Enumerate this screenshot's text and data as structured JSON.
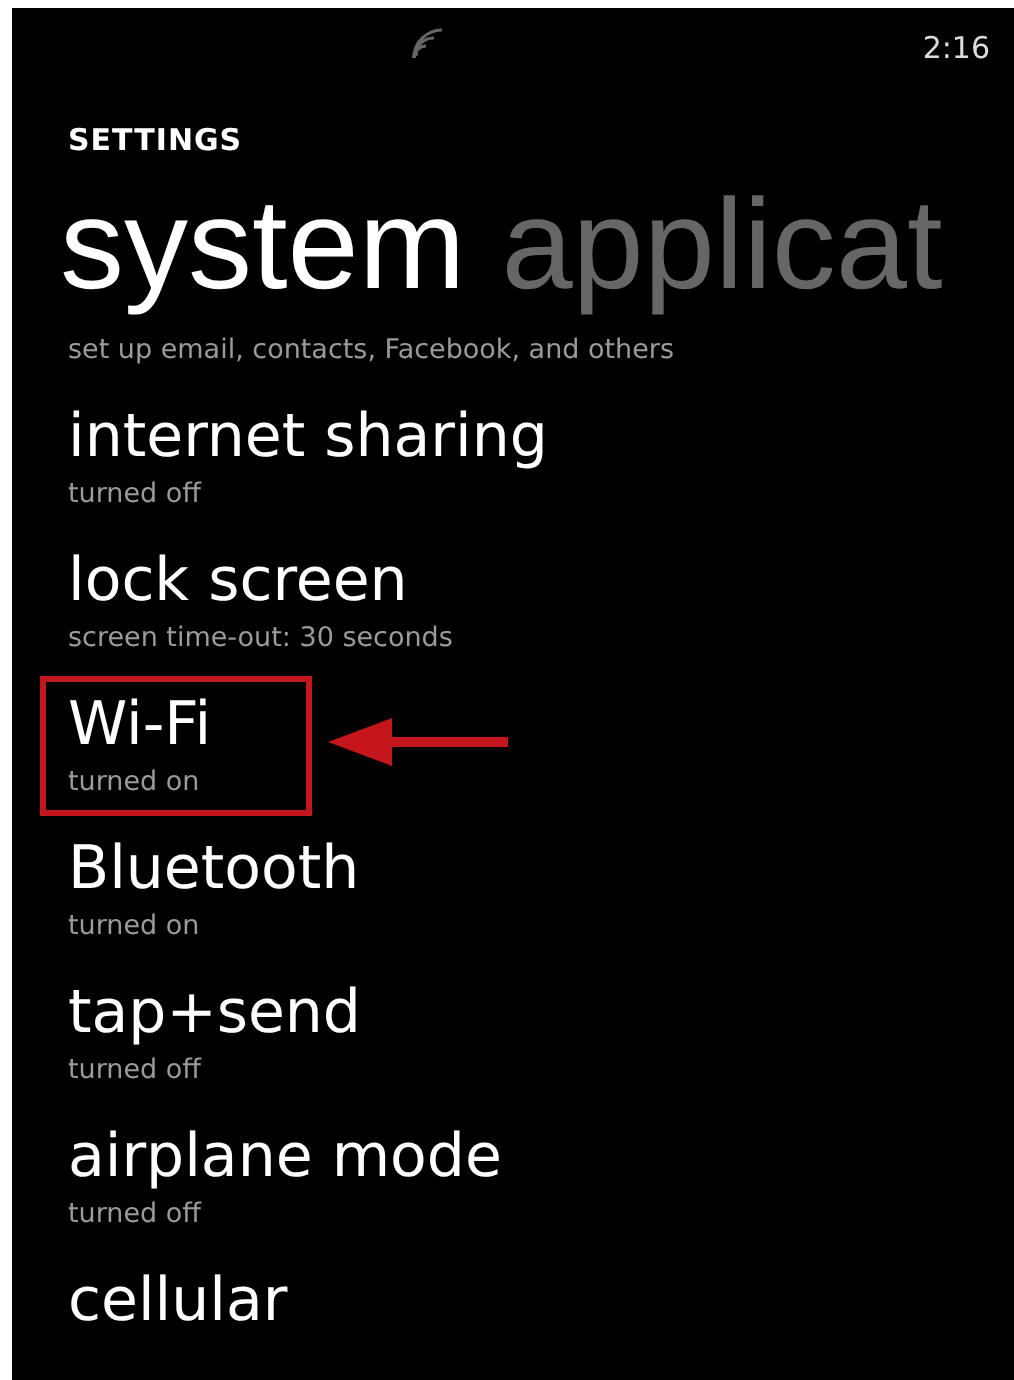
{
  "status_bar": {
    "time": "2:16"
  },
  "header": "SETTINGS",
  "pivots": [
    {
      "label": "system",
      "selected": true
    },
    {
      "label": "applicat",
      "selected": false
    }
  ],
  "items": [
    {
      "subtitle": "set up email, contacts, Facebook, and others",
      "highlighted": false
    },
    {
      "title": "internet sharing",
      "subtitle": "turned off",
      "highlighted": false
    },
    {
      "title": "lock screen",
      "subtitle": "screen time-out: 30 seconds",
      "highlighted": false
    },
    {
      "title": "Wi-Fi",
      "subtitle": "turned on",
      "highlighted": true
    },
    {
      "title": "Bluetooth",
      "subtitle": "turned on",
      "highlighted": false
    },
    {
      "title": "tap+send",
      "subtitle": "turned off",
      "highlighted": false
    },
    {
      "title": "airplane mode",
      "subtitle": "turned off",
      "highlighted": false
    },
    {
      "title": "cellular",
      "highlighted": false
    }
  ]
}
